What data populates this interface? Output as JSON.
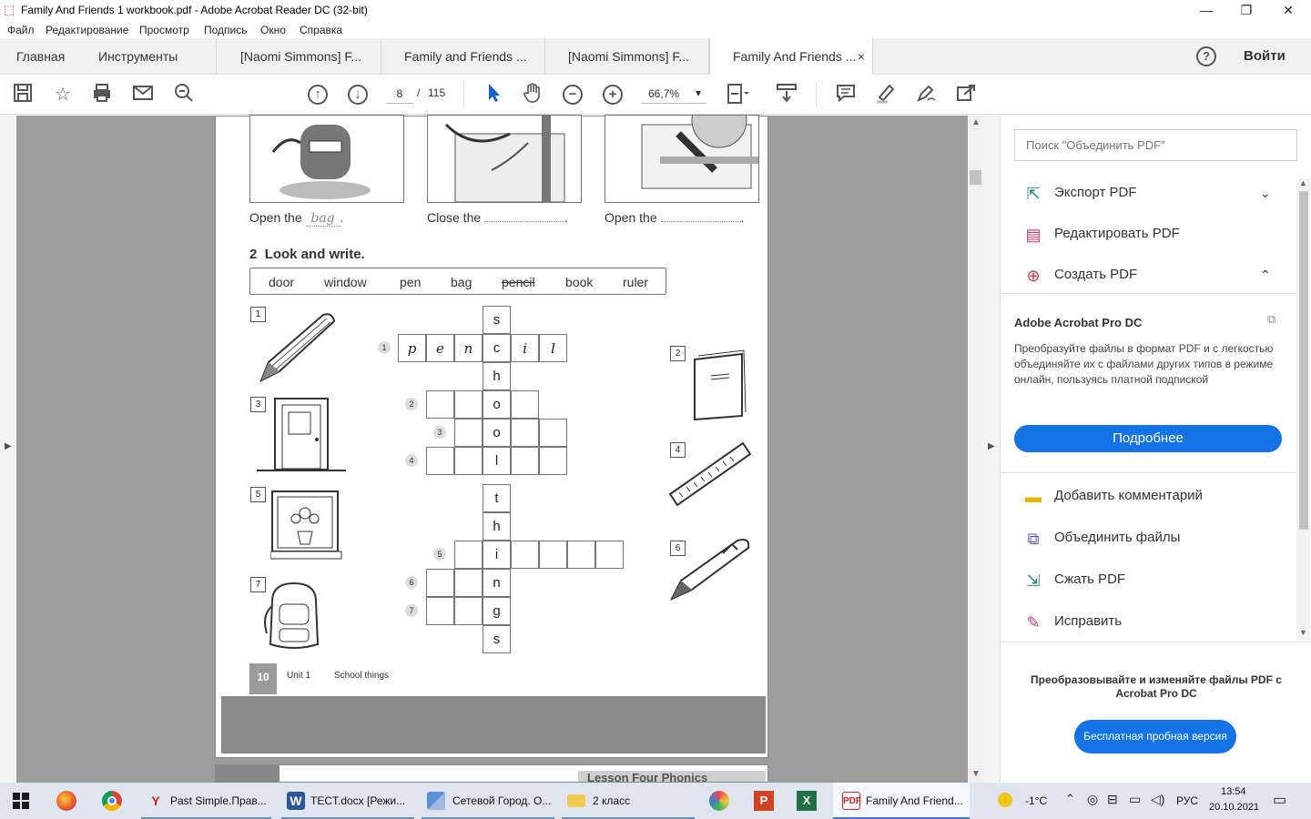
{
  "window": {
    "title": "Family And Friends 1 workbook.pdf - Adobe Acrobat Reader DC (32-bit)",
    "controls": {
      "minimize": "—",
      "maximize": "❐",
      "close": "✕"
    }
  },
  "menu": [
    "Файл",
    "Редактирование",
    "Просмотр",
    "Подпись",
    "Окно",
    "Справка"
  ],
  "tabs": {
    "home": "Главная",
    "tools": "Инструменты",
    "docs": [
      {
        "label": "[Naomi Simmons] F...",
        "active": false
      },
      {
        "label": "Family and Friends ...",
        "active": false
      },
      {
        "label": "[Naomi Simmons] F...",
        "active": false
      },
      {
        "label": "Family And Friends ...",
        "active": true
      }
    ],
    "close": "×",
    "help": "?",
    "signin": "Войти"
  },
  "toolbar": {
    "page_current": "8",
    "page_sep": "/",
    "page_total": "115",
    "zoom": "66,7%",
    "zoom_arrow": "▾"
  },
  "document": {
    "captions": [
      {
        "prefix": "Open the",
        "answer": "bag",
        "suffix": "."
      },
      {
        "prefix": "Close the",
        "answer": "",
        "suffix": "."
      },
      {
        "prefix": "Open the",
        "answer": "",
        "suffix": "."
      }
    ],
    "exercise_number": "2",
    "exercise_title": "Look and write.",
    "word_bank": [
      "door",
      "window",
      "pen",
      "bag",
      "pencil",
      "book",
      "ruler"
    ],
    "word_bank_struck": "pencil",
    "picture_numbers": [
      "1",
      "2",
      "3",
      "4",
      "5",
      "6",
      "7"
    ],
    "clue_numbers": [
      "1",
      "2",
      "3",
      "4",
      "5",
      "6",
      "7"
    ],
    "row1_letters": [
      "p",
      "e",
      "n",
      "c",
      "i",
      "l"
    ],
    "column1_letters": [
      "s",
      "c",
      "h",
      "o",
      "o",
      "l"
    ],
    "column2_letters": [
      "t",
      "h",
      "i",
      "n",
      "g",
      "s"
    ],
    "footer_page": "10",
    "footer_unit": "Unit 1",
    "footer_topic": "School things",
    "next_page_heading": "Lesson Four  Phonics"
  },
  "right_panel": {
    "search_placeholder": "Поиск \"Объединить PDF\"",
    "top_items": [
      {
        "label": "Экспорт PDF",
        "icon": "export-pdf-icon",
        "color": "#1b8a7a"
      },
      {
        "label": "Редактировать PDF",
        "icon": "edit-pdf-icon",
        "color": "#d6336c"
      },
      {
        "label": "Создать PDF",
        "icon": "create-pdf-icon",
        "color": "#d13d3d"
      }
    ],
    "promo": {
      "title": "Adobe Acrobat Pro DC",
      "text": "Преобразуйте файлы в формат PDF и с легкостью объединяйте их с файлами других типов в режиме онлайн, пользуясь платной подпиской",
      "button": "Подробнее"
    },
    "bottom_items": [
      {
        "label": "Добавить комментарий",
        "icon": "comment-icon",
        "color": "#e8b400"
      },
      {
        "label": "Объединить файлы",
        "icon": "combine-files-icon",
        "color": "#5a4fcf"
      },
      {
        "label": "Сжать PDF",
        "icon": "compress-pdf-icon",
        "color": "#1b8a7a"
      },
      {
        "label": "Исправить",
        "icon": "fill-sign-icon",
        "color": "#c2378a"
      }
    ],
    "footer_text": "Преобразовывайте и изменяйте файлы PDF с Acrobat Pro DC",
    "trial_button": "Бесплатная пробная версия"
  },
  "taskbar": {
    "items": [
      {
        "label": "Past Simple.Прав...",
        "icon": "yandex-icon"
      },
      {
        "label": "TECT.docx [Режи...",
        "icon": "word-icon"
      },
      {
        "label": "Сетевой Город. О...",
        "icon": "app-icon"
      },
      {
        "label": "2 класс",
        "icon": "folder-icon"
      },
      {
        "label": "Family And Friend...",
        "icon": "acrobat-icon"
      }
    ],
    "weather": "-1°C",
    "lang": "РУС",
    "time": "13:54",
    "date": "20.10.2021"
  },
  "colors": {
    "accent": "#1473e6",
    "doc_background": "#9c9c9c",
    "taskbar": "#dfe6ef"
  }
}
